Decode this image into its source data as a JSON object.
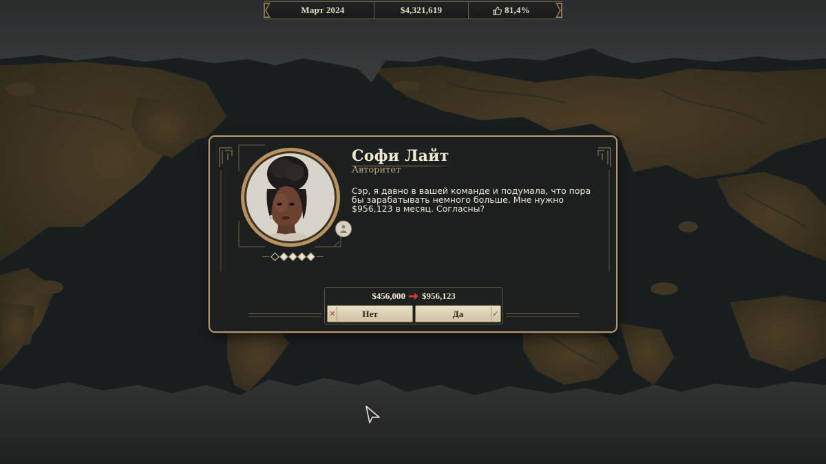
{
  "topbar": {
    "date": "Март 2024",
    "money": "$4,321,619",
    "approval": "81,4%",
    "approval_icon": "thumbs-up-icon"
  },
  "dialog": {
    "character_name": "Софи Лайт",
    "character_role": "Авторитет",
    "message": "Сэр, я давно в вашей команде и подумала, что пора бы зарабатывать немного больше. Мне нужно $956,123 в месяц. Согласны?",
    "stars_filled": 4,
    "stars_total": 5,
    "current_salary": "$456,000",
    "requested_salary": "$956,123",
    "no_label": "Нет",
    "yes_label": "Да",
    "no_icon": "close-icon",
    "yes_icon": "checkmark-icon"
  },
  "colors": {
    "accent_gold": "#b8956a",
    "panel_bg": "#1b1f1e",
    "arrow_red": "#d23a24",
    "name_text": "#f1e8d4",
    "role_text": "#c6ab7d"
  }
}
